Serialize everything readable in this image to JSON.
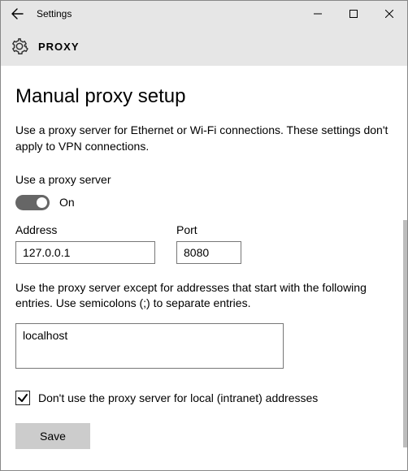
{
  "window": {
    "title": "Settings"
  },
  "header": {
    "title": "PROXY"
  },
  "main": {
    "heading": "Manual proxy setup",
    "description": "Use a proxy server for Ethernet or Wi-Fi connections. These settings don't apply to VPN connections.",
    "toggle_label": "Use a proxy server",
    "toggle_state": "On",
    "address_label": "Address",
    "address_value": "127.0.0.1",
    "port_label": "Port",
    "port_value": "8080",
    "exceptions_text": "Use the proxy server except for addresses that start with the following entries. Use semicolons (;) to separate entries.",
    "exceptions_value": "localhost",
    "local_checkbox_label": "Don't use the proxy server for local (intranet) addresses",
    "local_checkbox_checked": true,
    "save_label": "Save"
  }
}
